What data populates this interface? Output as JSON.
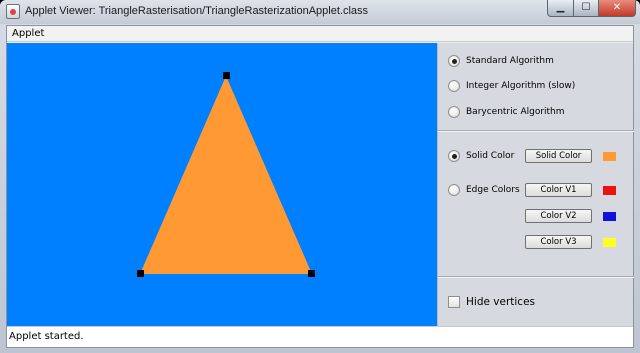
{
  "window": {
    "title": "Applet Viewer: TriangleRasterisation/TriangleRasterizationApplet.class",
    "minimize_glyph": "▁",
    "maximize_glyph": "☐",
    "close_glyph": "✕"
  },
  "menu": {
    "applet_label": "Applet"
  },
  "canvas": {
    "background": "#0080ff",
    "triangle_fill": "#ff9933",
    "vertex_color": "#000000"
  },
  "algorithms": [
    {
      "label": "Standard Algorithm",
      "selected": true
    },
    {
      "label": "Integer Algorithm (slow)",
      "selected": false
    },
    {
      "label": "Barycentric Algorithm",
      "selected": false
    }
  ],
  "coloring": {
    "solid": {
      "label": "Solid Color",
      "selected": true,
      "button": "Solid Color",
      "swatch": "#ff9933"
    },
    "edge": {
      "label": "Edge Colors",
      "selected": false
    },
    "v1": {
      "button": "Color V1",
      "swatch": "#ee1111"
    },
    "v2": {
      "button": "Color V2",
      "swatch": "#1111dd"
    },
    "v3": {
      "button": "Color V3",
      "swatch": "#ffff22"
    }
  },
  "options": {
    "hide_vertices_label": "Hide vertices",
    "hide_vertices_checked": false
  },
  "status": {
    "text": "Applet started."
  }
}
